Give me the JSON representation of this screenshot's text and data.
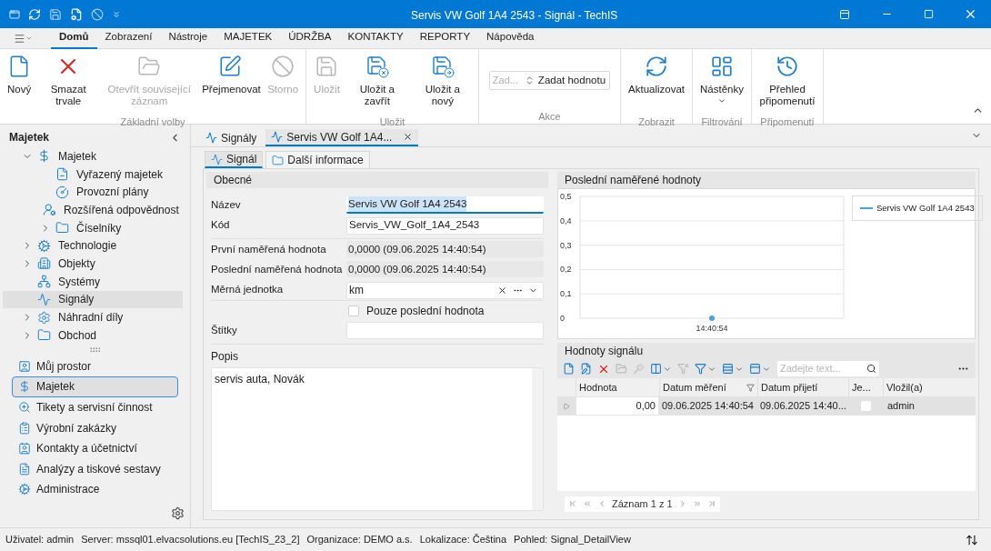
{
  "window": {
    "title": "Servis VW Golf 1A4 2543 - Signál - TechIS"
  },
  "menu_tabs": [
    {
      "label": "Domů",
      "selected": true
    },
    {
      "label": "Zobrazení",
      "selected": false
    },
    {
      "label": "Nástroje",
      "selected": false
    },
    {
      "label": "MAJETEK",
      "selected": false
    },
    {
      "label": "ÚDRŽBA",
      "selected": false
    },
    {
      "label": "KONTAKTY",
      "selected": false
    },
    {
      "label": "REPORTY",
      "selected": false
    },
    {
      "label": "Nápověda",
      "selected": false
    }
  ],
  "ribbon_groups": [
    {
      "label": "Základní volby",
      "kind": "buttons",
      "buttons": [
        {
          "label": "Nový",
          "kind": "new",
          "disabled": false
        },
        {
          "label": "Smazat trvale",
          "kind": "delete",
          "disabled": false
        },
        {
          "label": "Otevřít související záznam",
          "kind": "open",
          "disabled": true
        },
        {
          "label": "Přejmenovat",
          "kind": "rename",
          "disabled": false
        },
        {
          "label": "Storno",
          "kind": "cancel",
          "disabled": true
        }
      ]
    },
    {
      "label": "Uložit",
      "kind": "buttons",
      "buttons": [
        {
          "label": "Uložit",
          "kind": "save",
          "disabled": true
        },
        {
          "label": "Uložit a zavřít",
          "kind": "save-close",
          "disabled": false
        },
        {
          "label": "Uložit a nový",
          "kind": "save-new",
          "disabled": false
        }
      ]
    },
    {
      "label": "Akce",
      "kind": "value-entry",
      "placeholder": "Zad...",
      "button": "Zadat hodnotu"
    },
    {
      "label": "Zobrazit",
      "kind": "buttons",
      "buttons": [
        {
          "label": "Aktualizovat",
          "kind": "refresh",
          "disabled": false
        }
      ]
    },
    {
      "label": "Filtrování",
      "kind": "buttons",
      "buttons": [
        {
          "label": "Nástěnky",
          "kind": "dashboards",
          "disabled": false,
          "dropdown": true
        }
      ]
    },
    {
      "label": "Připomenutí",
      "kind": "buttons",
      "buttons": [
        {
          "label": "Přehled připomenutí",
          "kind": "history",
          "disabled": false
        }
      ]
    }
  ],
  "sidebar": {
    "title": "Majetek",
    "tree": [
      {
        "label": "Majetek",
        "kind": "asset",
        "expandable": true,
        "expanded": true,
        "selected": false,
        "children": [
          {
            "label": "Vyřazený majetek",
            "kind": "retired",
            "expandable": false,
            "expanded": false,
            "selected": false
          },
          {
            "label": "Provozní plány",
            "kind": "plan",
            "expandable": false,
            "expanded": false,
            "selected": false
          },
          {
            "label": "Rozšířená odpovědnost",
            "kind": "responsibility",
            "expandable": false,
            "expanded": false,
            "selected": false
          },
          {
            "label": "Číselníky",
            "kind": "folder",
            "expandable": true,
            "expanded": false,
            "selected": false
          }
        ]
      },
      {
        "label": "Technologie",
        "kind": "technology",
        "expandable": true,
        "expanded": false,
        "selected": false
      },
      {
        "label": "Objekty",
        "kind": "object",
        "expandable": true,
        "expanded": false,
        "selected": false
      },
      {
        "label": "Systémy",
        "kind": "system",
        "expandable": false,
        "expanded": false,
        "selected": false
      },
      {
        "label": "Signály",
        "kind": "signal",
        "expandable": false,
        "expanded": false,
        "selected": true
      },
      {
        "label": "Náhradní díly",
        "kind": "parts",
        "expandable": true,
        "expanded": false,
        "selected": false
      },
      {
        "label": "Obchod",
        "kind": "folder",
        "expandable": true,
        "expanded": false,
        "selected": false
      }
    ],
    "nav": [
      {
        "label": "Můj prostor",
        "kind": "user",
        "selected": false
      },
      {
        "label": "Majetek",
        "kind": "asset",
        "selected": true
      },
      {
        "label": "Tikety a servisní činnost",
        "kind": "tickets",
        "selected": false
      },
      {
        "label": "Výrobní zakázky",
        "kind": "orders",
        "selected": false
      },
      {
        "label": "Kontakty a účetnictví",
        "kind": "contacts",
        "selected": false
      },
      {
        "label": "Analýzy a tiskové sestavy",
        "kind": "reports",
        "selected": false
      },
      {
        "label": "Administrace",
        "kind": "admin",
        "selected": false
      }
    ]
  },
  "doc_tabs": [
    {
      "label": "Signály",
      "selected": false,
      "closable": false
    },
    {
      "label": "Servis VW Golf 1A4...",
      "selected": true,
      "closable": true
    }
  ],
  "sub_tabs": [
    {
      "label": "Signál",
      "kind": "signal",
      "selected": true
    },
    {
      "label": "Další informace",
      "kind": "folder",
      "selected": false
    }
  ],
  "form": {
    "section": "Obecné",
    "fields": [
      {
        "label": "Název",
        "kind": "text",
        "value": "Servis VW Golf 1A4 2543",
        "focused": true
      },
      {
        "label": "Kód",
        "kind": "text",
        "value": "Servis_VW_Golf_1A4_2543",
        "focused": false
      },
      {
        "label": "První naměřená hodnota",
        "kind": "readonly",
        "value": "0,0000 (09.06.2025 14:40:54)"
      },
      {
        "label": "Poslední naměřená hodnota",
        "kind": "readonly",
        "value": "0,0000 (09.06.2025 14:40:54)"
      },
      {
        "label": "Měrná jednotka",
        "kind": "lookup",
        "value": "km"
      },
      {
        "label": "Pouze poslední hodnota",
        "kind": "checkbox",
        "checked": false
      },
      {
        "label": "Štítky",
        "kind": "text",
        "focused": false
      }
    ],
    "description_label": "Popis",
    "description": "servis auta, Novák"
  },
  "chart_panel": {
    "title": "Poslední naměřené hodnoty",
    "chart_data": {
      "type": "line",
      "grid": true,
      "x": [
        "14:40:54"
      ],
      "series": [
        {
          "name": "Servis VW Golf 1A4 2543",
          "color": "#4aa3d8",
          "marker": true,
          "values": [
            0
          ]
        }
      ],
      "ylim": [
        0,
        0.5
      ],
      "yticks": [
        {
          "value": 0,
          "label": "0"
        },
        {
          "value": 0.1,
          "label": "0,1"
        },
        {
          "value": 0.2,
          "label": "0,2"
        },
        {
          "value": 0.3,
          "label": "0,3"
        },
        {
          "value": 0.4,
          "label": "0,4"
        },
        {
          "value": 0.5,
          "label": "0,5"
        }
      ]
    }
  },
  "grid_panel": {
    "title": "Hodnoty signálu",
    "search_placeholder": "Zadejte text...",
    "columns": [
      {
        "label": "Hodnota",
        "sorted": false
      },
      {
        "label": "Datum měření",
        "sorted": true
      },
      {
        "label": "Datum přijetí",
        "sorted": false
      },
      {
        "label": "Je...",
        "sorted": false
      },
      {
        "label": "Vložil(a)",
        "sorted": false
      }
    ],
    "rows": [
      {
        "selected": true,
        "value": "0,00",
        "measured": "09.06.2025 14:40:54",
        "received": "09.06.2025 14:40...",
        "flag": false,
        "inserted_by": "admin"
      }
    ],
    "pager": "Záznam 1 z 1"
  },
  "status_bar": [
    "Uživatel: admin",
    "Server: mssql01.elvacsolutions.eu [TechIS_23_2]",
    "Organizace: DEMO a.s.",
    "Lokalizace: Čeština",
    "Pohled: Signal_DetailView"
  ]
}
